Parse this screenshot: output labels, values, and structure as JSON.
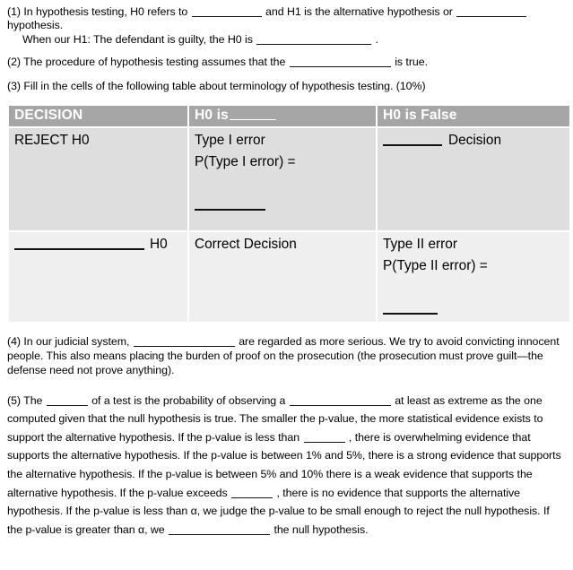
{
  "document": {
    "questions": {
      "q1": {
        "number": "(1)",
        "line1_a": "In hypothesis testing, H0  refers to",
        "line1_b": "and H1 is the alternative hypothesis or",
        "line1_c": "hypothesis.",
        "line2_a": "When our H1: The defendant is guilty, the H0  is",
        "line2_b": "."
      },
      "q2": {
        "number": "(2)",
        "text_a": "The procedure of hypothesis testing assumes that the",
        "text_b": "is true."
      },
      "q3": {
        "number": "(3)",
        "text": "Fill in the cells of the following table about terminology of hypothesis testing. (10%)"
      },
      "q4": {
        "number": "(4)",
        "text_a": "In our judicial system,",
        "text_b": "are regarded as more serious. We try to avoid convicting innocent people. This also means placing the burden of proof on the prosecution (the prosecution must prove guilt—the defense need not prove anything)."
      },
      "q5": {
        "number": "(5)",
        "seg1": "The",
        "seg2": "of a test is the probability of observing a",
        "seg3": "at least as extreme as the one computed given that the null hypothesis is true. The smaller the p-value, the more statistical evidence exists to support the alternative hypothesis. If the p-value is less than",
        "seg4": ", there is overwhelming evidence that supports the alternative hypothesis. If the p-value is between 1% and 5%, there is a strong evidence that supports the alternative hypothesis. If the p-value is between 5% and 10% there is a weak evidence that supports the alternative hypothesis. If the p-value exceeds",
        "seg5": ", there is no evidence that supports the alternative hypothesis. If the p-value is less than α, we judge the p-value to be small enough to reject the null hypothesis. If the p-value is greater than α, we",
        "seg6": "the null hypothesis."
      }
    },
    "table": {
      "headers": {
        "col1": "DECISION",
        "col2_prefix": "H0 is",
        "col3": "H0 is False"
      },
      "row1": {
        "col1": "REJECT H0",
        "col2_line1": "Type I error",
        "col2_line2": "P(Type I error) =",
        "col3_suffix": "Decision"
      },
      "row2": {
        "col1_suffix": "H0",
        "col2": "Correct Decision",
        "col3_line1": "Type II error",
        "col3_line2": "P(Type II error) ="
      }
    },
    "colors": {
      "header_background": "#a6a6a6",
      "header_text": "#ffffff",
      "row1_background": "#dedede",
      "row2_background": "#efefef",
      "body_text": "#000000"
    }
  }
}
